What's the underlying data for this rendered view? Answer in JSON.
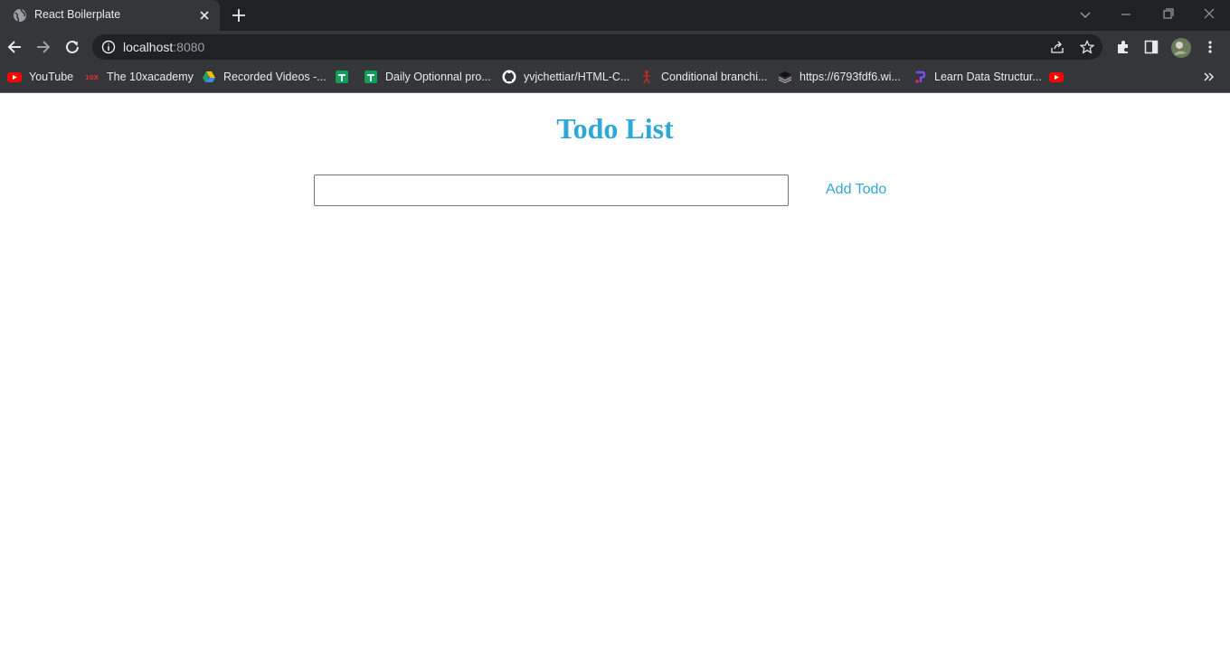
{
  "browser": {
    "tab": {
      "title": "React Boilerplate"
    },
    "url": {
      "host": "localhost",
      "port": ":8080"
    },
    "bookmarks": [
      {
        "label": "YouTube",
        "icon": "youtube-icon"
      },
      {
        "label": "The 10xacademy",
        "icon": "10x-icon"
      },
      {
        "label": "Recorded Videos -...",
        "icon": "google-drive-icon"
      },
      {
        "label": "",
        "icon": "google-sheets-icon"
      },
      {
        "label": "Daily Optionnal pro...",
        "icon": "google-sheets-icon"
      },
      {
        "label": "yvjchettiar/HTML-C...",
        "icon": "github-icon"
      },
      {
        "label": "Conditional branchi...",
        "icon": "figure-icon"
      },
      {
        "label": "https://6793fdf6.wi...",
        "icon": "layers-icon"
      },
      {
        "label": "Learn Data Structur...",
        "icon": "code-icon"
      },
      {
        "label": "",
        "icon": "youtube-icon"
      }
    ]
  },
  "app": {
    "title": "Todo List",
    "input": {
      "value": "",
      "placeholder": ""
    },
    "add_button_label": "Add Todo"
  },
  "colors": {
    "accent": "#2fa8d8",
    "chrome_dark": "#202124",
    "chrome": "#35363a"
  }
}
